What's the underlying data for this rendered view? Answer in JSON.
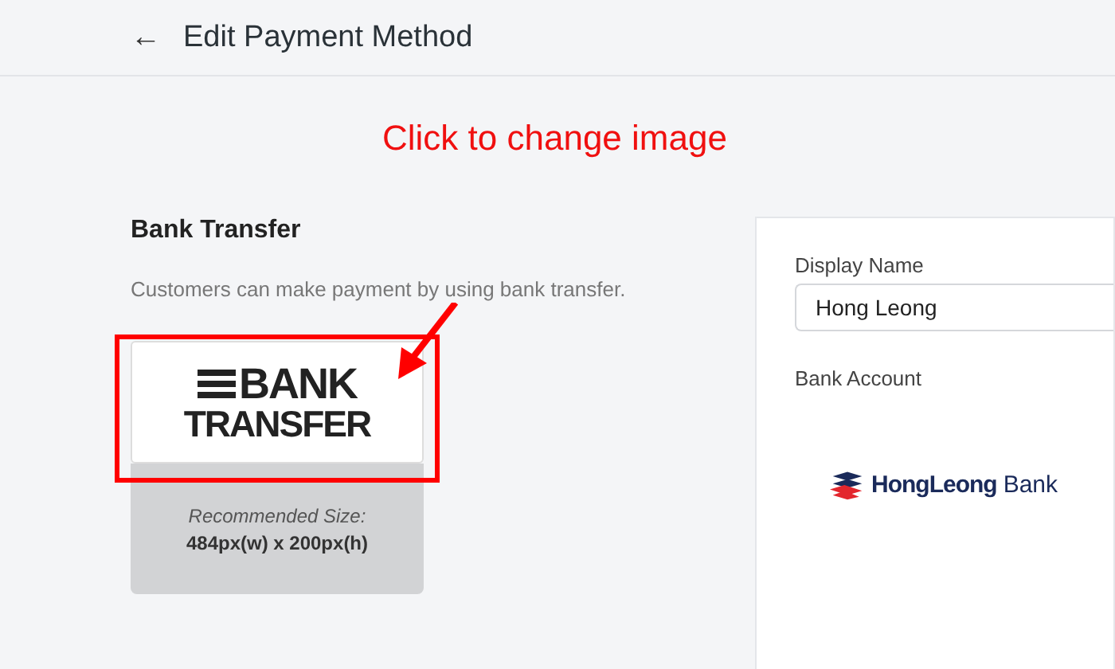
{
  "header": {
    "back_icon": "←",
    "title": "Edit Payment Method"
  },
  "annotation": {
    "text": "Click to change image"
  },
  "method": {
    "title": "Bank Transfer",
    "description": "Customers can make payment by using bank transfer.",
    "logo_lines": [
      "BANK",
      "TRANSFER"
    ],
    "recommended_label": "Recommended Size:",
    "recommended_size": "484px(w) x 200px(h)"
  },
  "form": {
    "display_name_label": "Display Name",
    "display_name_value": "Hong Leong",
    "bank_account_label": "Bank Account",
    "bank_logo": {
      "bold": "HongLeong",
      "light": "Bank"
    }
  }
}
